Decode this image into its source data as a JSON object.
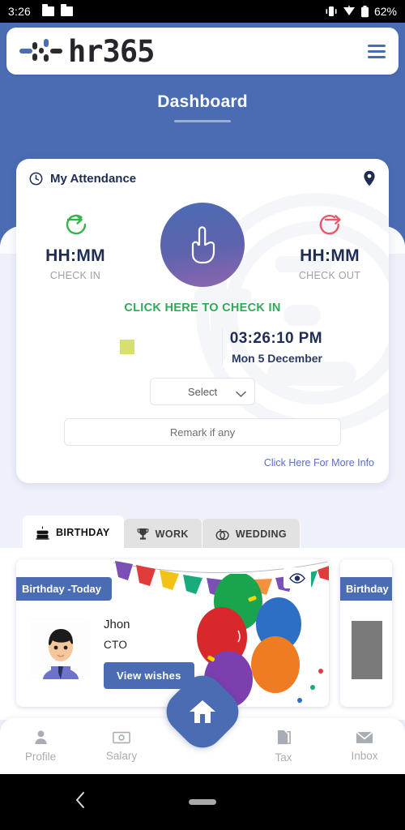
{
  "statusbar": {
    "time": "3:26",
    "battery": "62%",
    "icons": [
      "folder-icon",
      "folder-icon",
      "vibrate-icon",
      "wifi-icon",
      "battery-icon"
    ]
  },
  "appbar": {
    "brand": "hr365",
    "menu_icon": "hamburger-menu-icon"
  },
  "header": {
    "title": "Dashboard"
  },
  "attendance": {
    "card_title": "My Attendance",
    "clock_icon": "clock-icon",
    "location_icon": "location-pin-icon",
    "check_in": {
      "time": "HH:MM",
      "label": "CHECK IN"
    },
    "check_out": {
      "time": "HH:MM",
      "label": "CHECK OUT"
    },
    "cta": "CLICK HERE TO CHECK IN",
    "punch_icon": "pointing-hand-icon",
    "current_time": "03:26:10 PM",
    "current_date": "Mon 5 December",
    "select_value": "Select",
    "select_chevron": "chevron-down-icon",
    "remark_placeholder": "Remark if any",
    "more_info": "Click Here For More Info",
    "colors": {
      "check_in": "#2eac55",
      "check_out": "#e8596b",
      "swatch": "#d7e06e",
      "link": "#5b6fc0"
    }
  },
  "events": {
    "tabs": [
      {
        "label": "BIRTHDAY",
        "icon": "birthday-cake-icon",
        "active": true
      },
      {
        "label": "WORK",
        "icon": "trophy-icon",
        "active": false
      },
      {
        "label": "WEDDING",
        "icon": "wedding-rings-icon",
        "active": false
      }
    ],
    "cards": [
      {
        "badge": "Birthday -Today",
        "name": "Jhon",
        "role": "CTO",
        "button": "View wishes",
        "eye_icon": "eye-icon"
      },
      {
        "badge": "Birthday"
      }
    ]
  },
  "bottom_nav": {
    "items": [
      {
        "label": "Profile",
        "icon": "person-icon"
      },
      {
        "label": "Salary",
        "icon": "money-bill-icon"
      },
      {
        "label": "Tax",
        "icon": "document-icon"
      },
      {
        "label": "Inbox",
        "icon": "envelope-icon"
      }
    ],
    "home": {
      "icon": "home-icon"
    }
  },
  "android_nav": {
    "back_icon": "back-chevron-icon",
    "home_pill": "home-indicator"
  },
  "theme": {
    "primary": "#4a6cb3",
    "page_bg": "#eef0fa"
  }
}
